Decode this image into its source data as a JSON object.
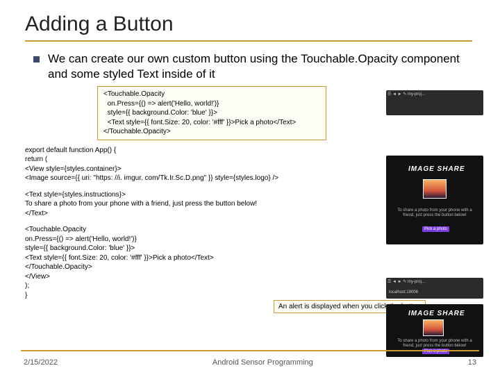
{
  "title": "Adding a Button",
  "bullet": "We can create our own custom button using the Touchable.Opacity component and some styled Text inside of it",
  "code_box": "<Touchable.Opacity\n  on.Press={() => alert('Hello, world!')}\n  style={{ background.Color: 'blue' }}>\n  <Text style={{ font.Size: 20, color: '#fff' }}>Pick a photo</Text>\n</Touchable.Opacity>",
  "code_main_a": "export default function App() {\nreturn (\n<View style={styles.container}>\n<Image source={{ uri: \"https: //i. imgur. com/Tk.Ir.Sc.D.png\" }} style={styles.logo} />",
  "code_main_b": "<Text style={styles.instructions}>\nTo share a photo from your phone with a friend, just press the button below!\n</Text>",
  "code_main_c": "<Touchable.Opacity\non.Press={() => alert('Hello, world!')}\nstyle={{ background.Color: 'blue' }}>\n<Text style={{ font.Size: 20, color: '#fff' }}>Pick a photo</Text>\n</Touchable.Opacity>\n</View>\n);\n}",
  "caption": "An alert is displayed when you click the button",
  "footer": {
    "date": "2/15/2022",
    "center": "Android Sensor Programming",
    "page": "13"
  },
  "mock": {
    "share": "IMAGE SHARE",
    "tiny": "To share a photo from your phone with a friend, just press the button below!",
    "pick": "Pick a photo",
    "tab": "☰  ◄ ►  ✎ my-proj…",
    "local": "localhost:19006"
  }
}
